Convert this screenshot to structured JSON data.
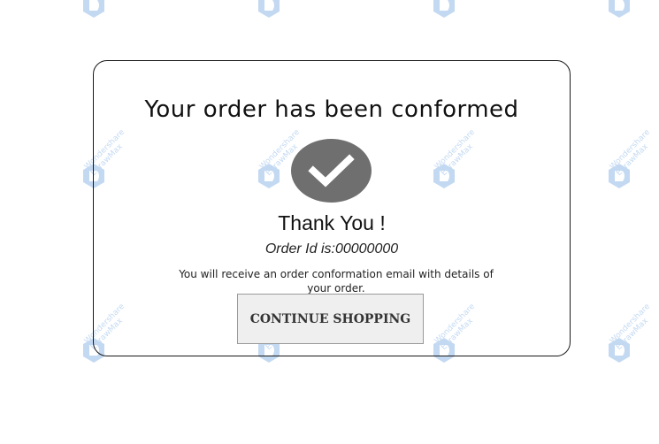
{
  "dialog": {
    "title": "Your order has been conformed",
    "thanks": "Thank You !",
    "order_id": "Order Id is:00000000",
    "message": "You will receive an order conformation email with details of your order.",
    "continue_label": "CONTINUE SHOPPING"
  },
  "watermark": {
    "line1": "Wondershare",
    "line2": "EdrawMax",
    "icon": "edrawmax-logo-icon"
  },
  "colors": {
    "check_circle": "#6f6f6f",
    "button_bg": "#efefef",
    "watermark": "#2b7bd4"
  }
}
